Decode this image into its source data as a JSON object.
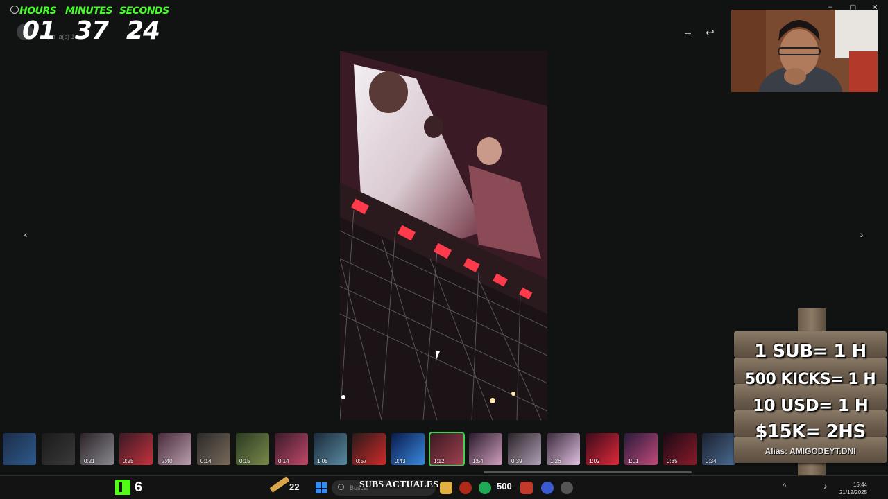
{
  "timer": {
    "hours_label": "HOURS",
    "minutes_label": "MINUTES",
    "seconds_label": "SECONDS",
    "hours": "01",
    "minutes": "37",
    "seconds": "24",
    "label_color": "#49ff2b"
  },
  "chat": {
    "subtitle": "hoy a la(s) 1"
  },
  "viewer": {
    "actions": [
      {
        "icon": "forward-icon",
        "glyph": "→"
      },
      {
        "icon": "reply-icon",
        "glyph": "↩"
      }
    ],
    "prev_glyph": "‹",
    "next_glyph": "›"
  },
  "window_controls": [
    {
      "icon": "minimize-icon",
      "glyph": "–"
    },
    {
      "icon": "maximize-icon",
      "glyph": "▢"
    },
    {
      "icon": "close-icon",
      "glyph": "✕"
    }
  ],
  "thumbnails": [
    {
      "duration": "",
      "kind": "doc"
    },
    {
      "duration": "",
      "kind": "doc"
    },
    {
      "duration": "0:21",
      "kind": "video"
    },
    {
      "duration": "0:25",
      "kind": "video"
    },
    {
      "duration": "2:40",
      "kind": "video"
    },
    {
      "duration": "0:14",
      "kind": "video"
    },
    {
      "duration": "0:15",
      "kind": "video"
    },
    {
      "duration": "0:14",
      "kind": "video"
    },
    {
      "duration": "1:05",
      "kind": "video"
    },
    {
      "duration": "0:57",
      "kind": "video"
    },
    {
      "duration": "0:43",
      "kind": "video"
    },
    {
      "duration": "1:12",
      "kind": "video",
      "selected": true
    },
    {
      "duration": "1:54",
      "kind": "video"
    },
    {
      "duration": "0:39",
      "kind": "video"
    },
    {
      "duration": "1:26",
      "kind": "video"
    },
    {
      "duration": "1:02",
      "kind": "video"
    },
    {
      "duration": "1:01",
      "kind": "video"
    },
    {
      "duration": "0:35",
      "kind": "video"
    },
    {
      "duration": "0:34",
      "kind": "video"
    }
  ],
  "sign": {
    "line1": "1 SUB= 1 H",
    "line2": "500 KICKS= 1 H",
    "line3": "10 USD= 1 H",
    "line4": "$15K= 2HS",
    "alias": "Alias: AMIGODEYT.DNI"
  },
  "taskbar": {
    "kick_count": "6",
    "pencil_count": "22",
    "search_placeholder": "Buscar",
    "subs_title": "SUBS ACTUALES",
    "subs_count": "500",
    "time": "15:44",
    "date": "21/12/2025",
    "kick_color": "#53fc18"
  }
}
